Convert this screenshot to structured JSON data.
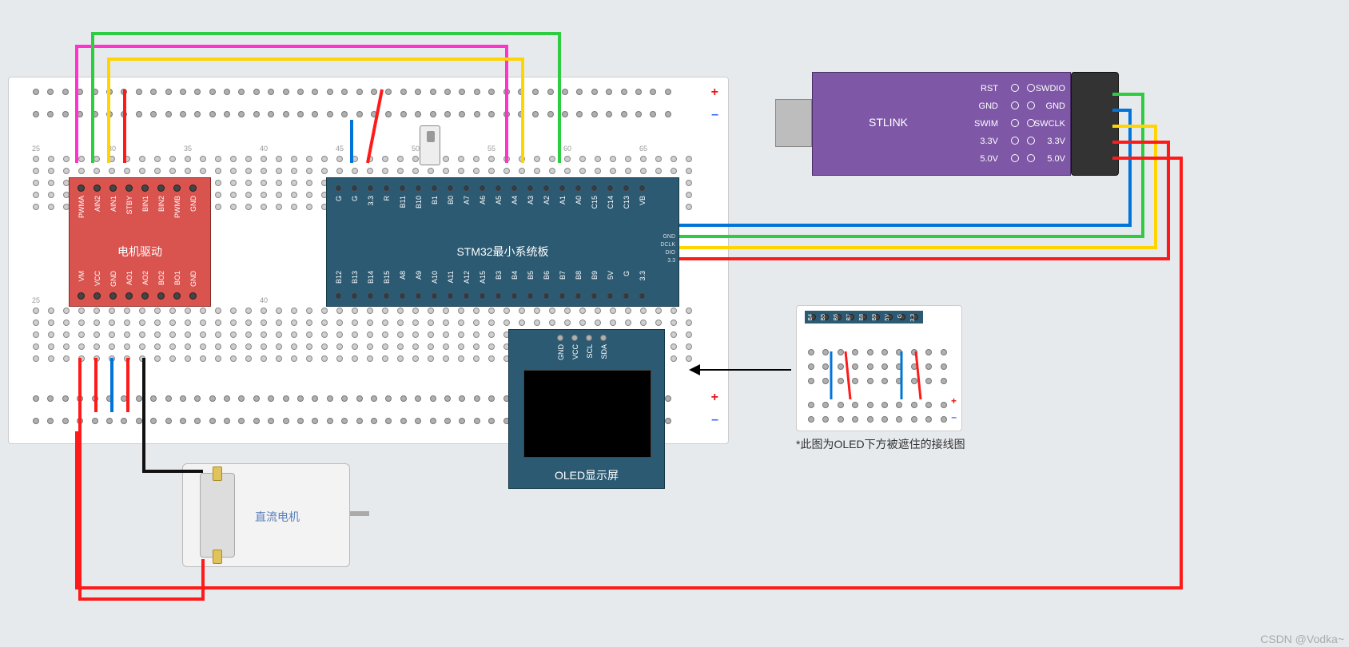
{
  "modules": {
    "motor_driver": {
      "title": "电机驱动",
      "top_pins": [
        "PWMA",
        "AIN2",
        "AIN1",
        "STBY",
        "BIN1",
        "BIN2",
        "PWMB",
        "GND"
      ],
      "bottom_pins": [
        "VM",
        "VCC",
        "GND",
        "AO1",
        "AO2",
        "BO2",
        "BO1",
        "GND"
      ]
    },
    "stm32": {
      "title": "STM32最小系统板",
      "top_pins": [
        "G",
        "G",
        "3.3",
        "R",
        "B11",
        "B10",
        "B1",
        "B0",
        "A7",
        "A6",
        "A5",
        "A4",
        "A3",
        "A2",
        "A1",
        "A0",
        "C15",
        "C14",
        "C13",
        "VB"
      ],
      "bottom_pins": [
        "B12",
        "B13",
        "B14",
        "B15",
        "A8",
        "A9",
        "A10",
        "A11",
        "A12",
        "A15",
        "B3",
        "B4",
        "B5",
        "B6",
        "B7",
        "B8",
        "B9",
        "5V",
        "G",
        "3.3"
      ],
      "side_labels": [
        "GND",
        "DCLK",
        "DIO",
        "3.3"
      ]
    },
    "oled": {
      "title": "OLED显示屏",
      "pins": [
        "GND",
        "VCC",
        "SCL",
        "SDA"
      ]
    },
    "stlink": {
      "title": "STLINK",
      "left_col": [
        "RST",
        "GND",
        "SWIM",
        "3.3V",
        "5.0V"
      ],
      "right_col": [
        "SWDIO",
        "GND",
        "SWCLK",
        "3.3V",
        "5.0V"
      ]
    },
    "dc_motor": {
      "title": "直流电机"
    },
    "detail": {
      "caption": "*此图为OLED下方被遮住的接线图",
      "pins": [
        "B4",
        "B5",
        "B6",
        "B7",
        "B8",
        "B9",
        "5V",
        "G",
        "3.3"
      ]
    }
  },
  "rails": {
    "plus": "+",
    "minus": "–"
  },
  "colors": {
    "red": "#ff1a1a",
    "green": "#2ecc40",
    "blue": "#0074d9",
    "yellow": "#ffd400",
    "magenta": "#ff33cc",
    "black": "#111111"
  },
  "watermark": "CSDN @Vodka~"
}
